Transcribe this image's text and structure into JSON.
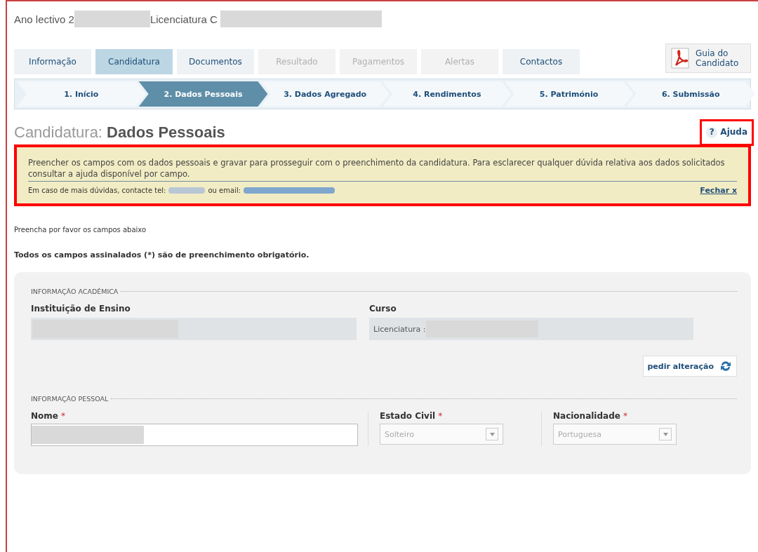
{
  "header": {
    "year_label": "Ano lectivo 2",
    "course_label": "Licenciatura C"
  },
  "tabs": [
    {
      "label": "Informação",
      "selected": false,
      "disabled": false
    },
    {
      "label": "Candidatura",
      "selected": true,
      "disabled": false
    },
    {
      "label": "Documentos",
      "selected": false,
      "disabled": false
    },
    {
      "label": "Resultado",
      "selected": false,
      "disabled": true
    },
    {
      "label": "Pagamentos",
      "selected": false,
      "disabled": true
    },
    {
      "label": "Alertas",
      "selected": false,
      "disabled": true
    },
    {
      "label": "Contactos",
      "selected": false,
      "disabled": false
    }
  ],
  "guide_button": {
    "label": "Guia do Candidato"
  },
  "steps": [
    {
      "label": "1. Início",
      "selected": false
    },
    {
      "label": "2. Dados Pessoais",
      "selected": true
    },
    {
      "label": "3. Dados Agregado",
      "selected": false
    },
    {
      "label": "4. Rendimentos",
      "selected": false
    },
    {
      "label": "5. Património",
      "selected": false
    },
    {
      "label": "6. Submissão",
      "selected": false
    }
  ],
  "page_title": {
    "prefix": "Candidatura:",
    "title": "Dados Pessoais"
  },
  "help_button": {
    "icon": "?",
    "label": "Ajuda"
  },
  "info_box": {
    "text": "Preencher os campos com os dados pessoais e gravar para prosseguir com o preenchimento da candidatura. Para esclarecer qualquer dúvida relativa aos dados solicitados consultar a ajuda disponível por campo.",
    "contact_label": "Em caso de mais dúvidas, contacte tel:",
    "email_label": "ou email:",
    "close_link": "Fechar x"
  },
  "intro": "Preencha por favor os campos abaixo",
  "required_note": "Todos os campos assinalados (*) são de preenchimento obrigatório.",
  "academic": {
    "legend": "INFORMAÇÃO ACADÉMICA",
    "institution_label": "Instituição de Ensino",
    "course_label": "Curso",
    "course_prefix": "Licenciatura :",
    "change_button": "pedir alteração"
  },
  "personal": {
    "legend": "INFORMAÇÃO PESSOAL",
    "fields": [
      {
        "label": "Nome",
        "required": "*",
        "kind": "text",
        "disabled": false
      },
      {
        "label": "Estado Civil",
        "required": "*",
        "kind": "select",
        "value": "Solteiro",
        "disabled": true
      },
      {
        "label": "Nacionalidade",
        "required": "*",
        "kind": "select",
        "value": "Portuguesa",
        "disabled": true
      }
    ]
  }
}
